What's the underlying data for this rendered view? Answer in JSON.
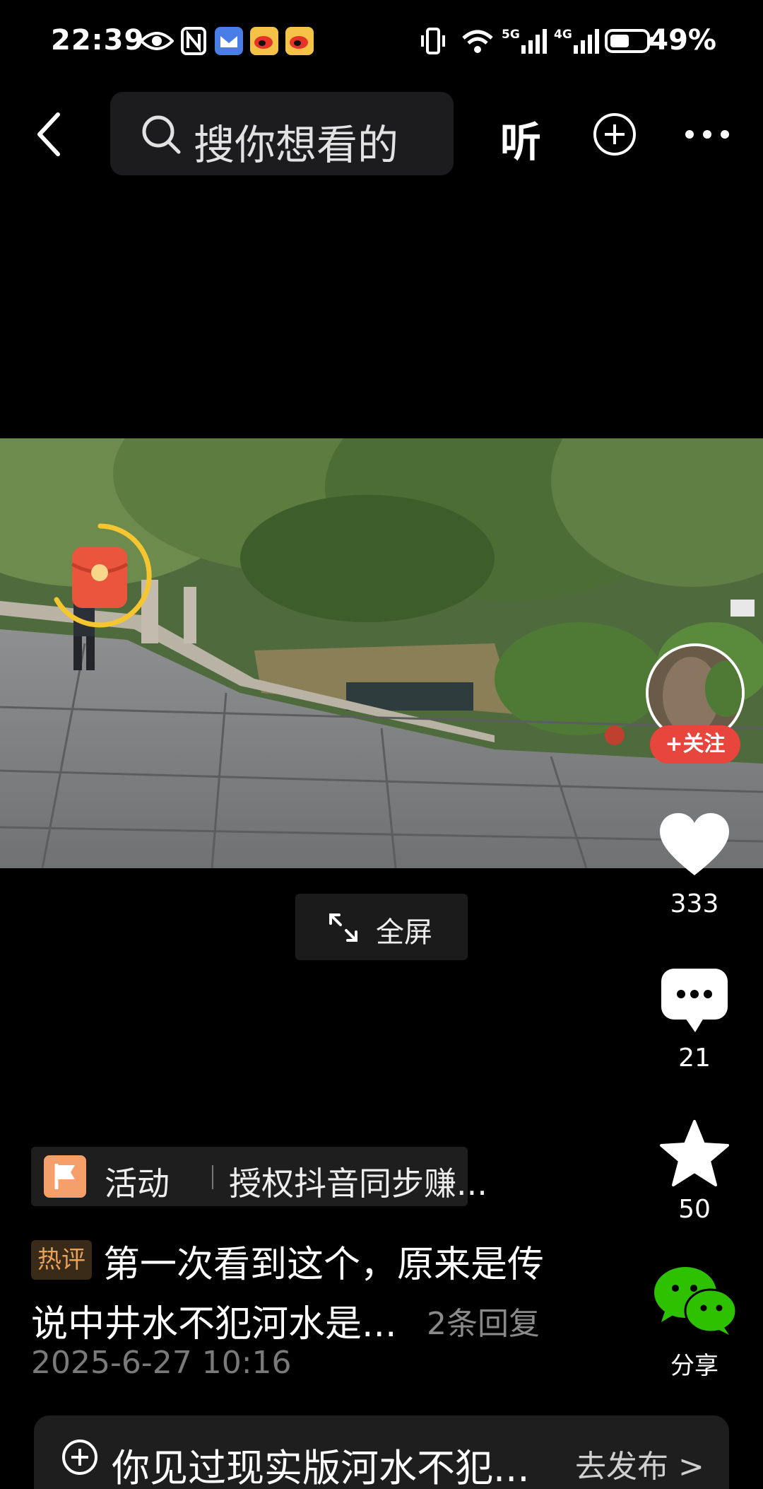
{
  "status_bar": {
    "time": "22:39",
    "battery_percent": "49%",
    "network_5g": "5G",
    "network_4g": "4G"
  },
  "top_nav": {
    "search_placeholder": "搜你想看的",
    "listen_label": "听"
  },
  "video": {
    "fullscreen_label": "全屏"
  },
  "right_rail": {
    "follow_label": "+关注",
    "like_count": "333",
    "comment_count": "21",
    "favorite_count": "50",
    "share_label": "分享"
  },
  "activity": {
    "title": "活动",
    "description": "授权抖音同步赚..."
  },
  "comment": {
    "badge": "热评",
    "line1": "第一次看到这个，原来是传",
    "line2": "说中井水不犯河水是...",
    "replies": "2条回复",
    "date": "2025-6-27 10:16"
  },
  "publish_bar": {
    "text": "你见过现实版河水不犯...",
    "action": "去发布 >"
  },
  "colors": {
    "background": "#000000",
    "follow_red": "#e8453c",
    "wechat_green": "#2dc100",
    "hot_badge_text": "#e6a25a",
    "activity_flag": "#f5a06a"
  }
}
